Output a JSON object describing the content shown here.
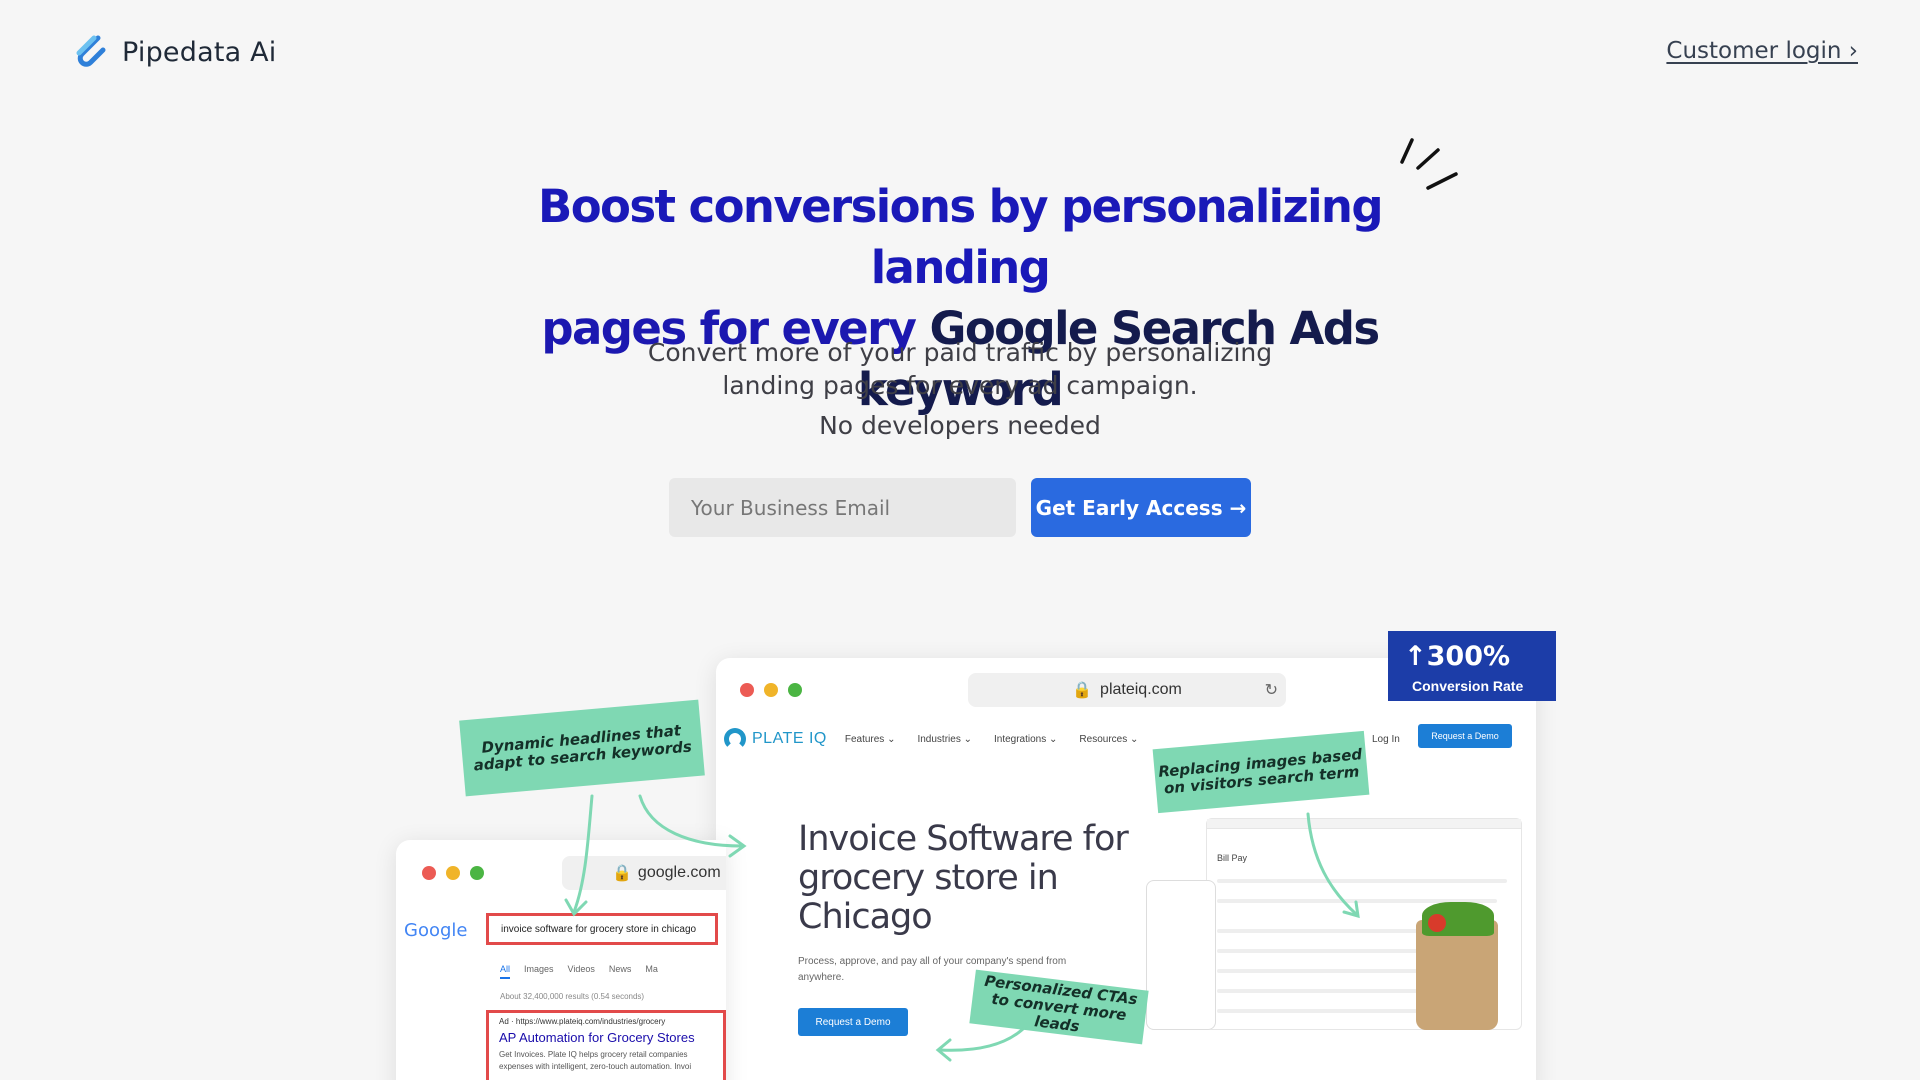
{
  "header": {
    "brand": "Pipedata Ai",
    "login_label": "Customer login ›"
  },
  "hero": {
    "title_line1": "Boost conversions by personalizing landing",
    "title_line2_a": "pages for every",
    "title_line2_b": "Google Search Ads keyword",
    "subtitle_line1": "Convert more of your paid traffic by personalizing",
    "subtitle_line2": "landing pages for every ad campaign.",
    "subtitle_tag": "No developers needed"
  },
  "signup": {
    "email_placeholder": "Your Business Email",
    "cta_label": "Get Early Access →"
  },
  "main_browser": {
    "url": "plateiq.com",
    "brand": "PLATE IQ",
    "nav": [
      "Features ⌄",
      "Industries ⌄",
      "Integrations ⌄",
      "Resources ⌄"
    ],
    "login": "Log In",
    "nav_cta": "Request a Demo",
    "headline": "Invoice Software for grocery store in Chicago",
    "description": "Process, approve, and pay all of your company's spend from anywhere.",
    "cta": "Request a Demo",
    "dashboard_title": "Bill Pay"
  },
  "badge": {
    "value": "↑300%",
    "label": "Conversion Rate"
  },
  "google_browser": {
    "url": "google.com",
    "logo": "Google",
    "query": "invoice software for grocery store in chicago",
    "tabs": [
      "All",
      "Images",
      "Videos",
      "News",
      "Ma"
    ],
    "results_count": "About 32,400,000 results (0.54 seconds)",
    "ad_url": "Ad · https://www.plateiq.com/industries/grocery",
    "ad_title": "AP Automation for Grocery Stores",
    "ad_desc": "Get Invoices. Plate IQ helps grocery retail companies expenses with intelligent, zero-touch automation. Invoi"
  },
  "notes": {
    "headlines": "Dynamic headlines that adapt to search keywords",
    "images": "Replacing images based on visitors search term",
    "ctas": "Personalized CTAs to convert more leads"
  },
  "colors": {
    "accent_blue": "#2a6ae0",
    "title_blue": "#1a19b8",
    "title_navy": "#141b4d",
    "note_green": "#7fd8b3",
    "badge_blue": "#1c3da8"
  }
}
